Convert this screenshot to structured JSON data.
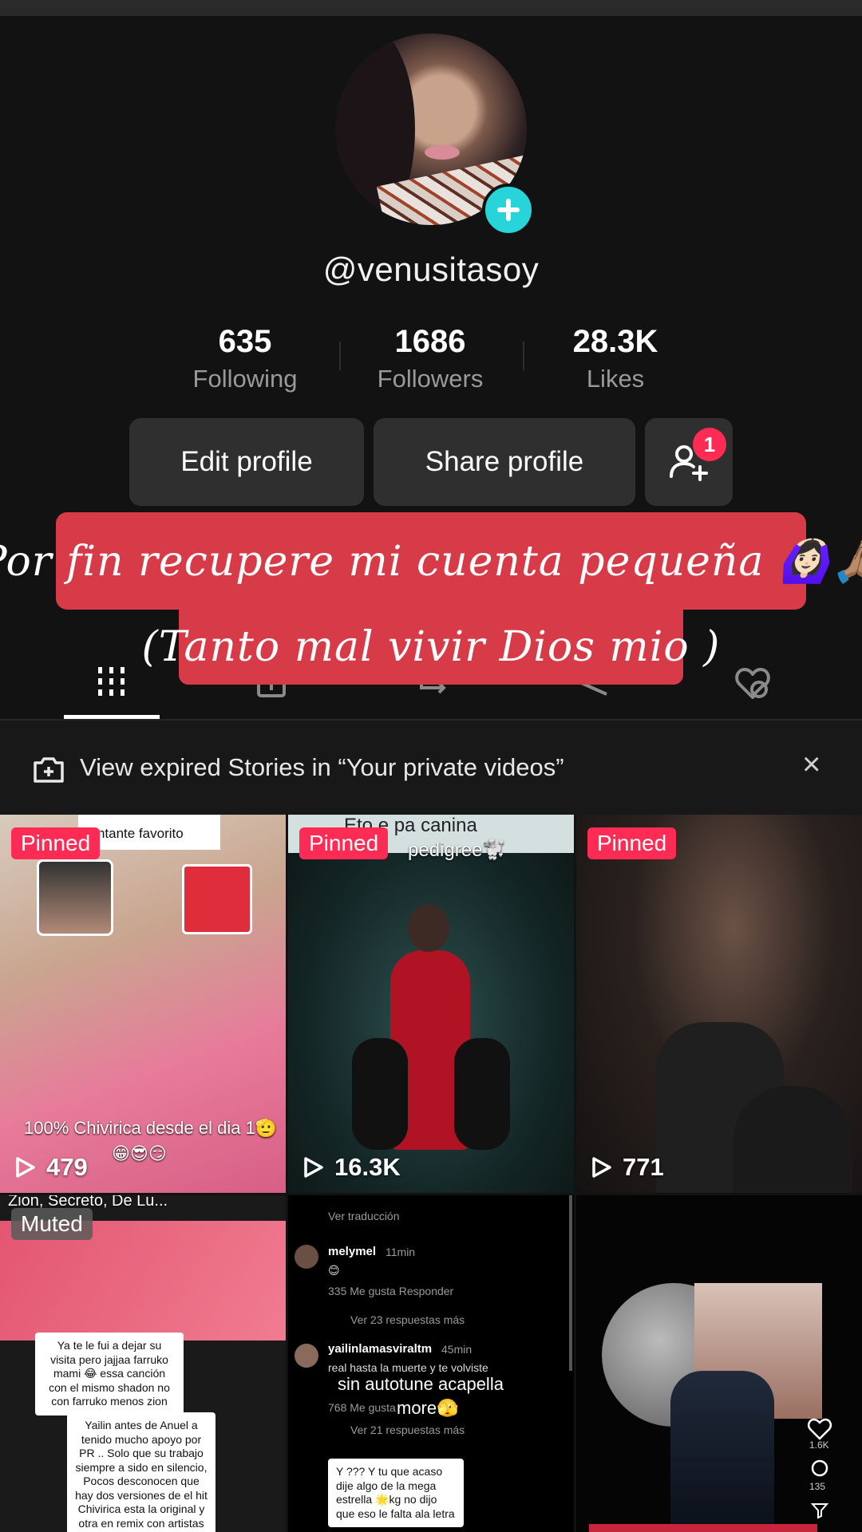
{
  "profile": {
    "username": "@venusitasoy",
    "stats": [
      {
        "value": "635",
        "label": "Following"
      },
      {
        "value": "1686",
        "label": "Followers"
      },
      {
        "value": "28.3K",
        "label": "Likes"
      }
    ],
    "edit_label": "Edit profile",
    "share_label": "Share profile",
    "friend_badge": "1"
  },
  "caption": {
    "line1": "Por fin recupere mi cuenta pequeña 🙆🏻‍♀️🙏🏽",
    "line2": "(Tanto mal vivir Dios mio )"
  },
  "tabs": [
    {
      "name": "videos-tab",
      "icon": "grid-icon",
      "active": true
    },
    {
      "name": "private-tab",
      "icon": "lock-icon"
    },
    {
      "name": "reposts-tab",
      "icon": "repost-icon"
    },
    {
      "name": "favorites-tab",
      "icon": "bookmark-icon"
    },
    {
      "name": "liked-tab",
      "icon": "heart-hidden-icon"
    }
  ],
  "banner": {
    "text": "View expired Stories in “Your private videos”",
    "close": "×"
  },
  "videos": [
    {
      "label": "Pinned",
      "views": "479",
      "texts": [
        "cantante favorito",
        "100%  Chivirica  desde el dia 1🫡",
        "😁😎😏"
      ]
    },
    {
      "label": "Pinned",
      "views": "16.3K",
      "texts": [
        "Eto e pa canina",
        "pedigree🐩"
      ]
    },
    {
      "label": "Pinned",
      "views": "771",
      "texts": []
    },
    {
      "label": "Muted",
      "views": "",
      "texts": [
        "Zion, Secreto, De Lu..."
      ]
    },
    {
      "label": "",
      "views": "",
      "texts": []
    },
    {
      "label": "",
      "views": "",
      "texts": []
    }
  ],
  "comments_cell": {
    "ver_traduccion": "Ver traducción",
    "c1_name": "melymel",
    "c1_time": "11min",
    "c1_text": "😊",
    "c1_meta": "335 Me gusta    Responder",
    "c1_more": "Ver 23 respuestas más",
    "c2_name": "yailinlamasviraltm",
    "c2_time": "45min",
    "c2_text": "real hasta la muerte y te volviste",
    "overlay1": "sin autotune acapella",
    "overlay2": "more🫣",
    "c2_meta": "768 Me gusta",
    "c2_more": "Ver 21 respuestas más",
    "reply_box": "Y ??? Y tu que acaso dije algo de la mega estrella 🌟kg no dijo que eso le falta ala letra"
  },
  "muted_cell": {
    "reply_top": "Ya te le fui a dejar su visita pero jajjaa farruko mami 😂 essa canción con el mismo shadon no con farruko menos zion",
    "reply_body": "Yailin antes de Anuel a tenido mucho apoyo por PR .. Solo que su trabajo siempre a sido en silencio, Pocos desconocen que hay dos versiones de el hit Chivirica esta la original y otra en remix con artistas de PR mas tiene featurings con ñengo flow"
  },
  "side_rail": {
    "likes": "1.6K",
    "comments": "135"
  },
  "colors": {
    "background": "#121212",
    "accent_pink": "#fe2c55",
    "caption_red": "#d73b48",
    "add_cyan": "#26d4d9",
    "button_gray": "#2f2f2f"
  }
}
